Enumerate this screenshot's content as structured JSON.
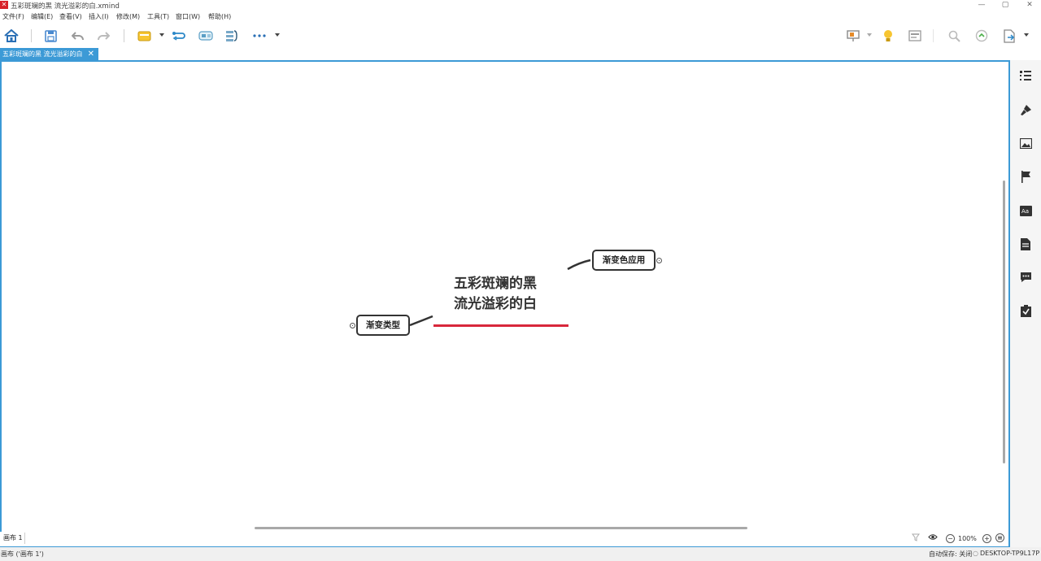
{
  "window": {
    "title": "五彩斑斓的黑 流光溢彩的白.xmind",
    "logo": "✕",
    "controls": [
      "—",
      "▢",
      "✕"
    ]
  },
  "menu": [
    "文件(F)",
    "编辑(E)",
    "查看(V)",
    "插入(I)",
    "修改(M)",
    "工具(T)",
    "窗口(W)",
    "帮助(H)"
  ],
  "toolbar": {
    "left_icons": [
      "home-icon",
      "save-icon",
      "undo-icon",
      "redo-icon",
      "topic-icon",
      "relationship-icon",
      "boundary-icon",
      "summary-icon",
      "more-icon"
    ],
    "right_icons": [
      "presentation-icon",
      "idea-icon",
      "outline-icon",
      "zoom-icon",
      "share-icon",
      "export-icon"
    ]
  },
  "tab": {
    "label": "五彩斑斓的黑 流光溢彩的白",
    "close": "✕"
  },
  "mindmap": {
    "central_line1": "五彩斑斓的黑",
    "central_line2": "流光溢彩的白",
    "central_underline_color": "#d8273b",
    "topic_right": "渐变色应用",
    "topic_left": "渐变类型"
  },
  "status": {
    "sheet_tab": "画布 1",
    "zoom": "100%",
    "zoom_out": "−",
    "zoom_in": "+"
  },
  "bottom": {
    "left_text": "画布 ('画布 1')",
    "autosave": "自动保存: 关闭",
    "machine": "DESKTOP-TP9L17P"
  },
  "right_panel_icons": [
    "outline-list-icon",
    "format-brush-icon",
    "image-icon",
    "flag-icon",
    "text-style-icon",
    "note-icon",
    "comment-icon",
    "task-icon"
  ],
  "colors": {
    "accent": "#3c9ad6",
    "logo": "#d8232a"
  }
}
